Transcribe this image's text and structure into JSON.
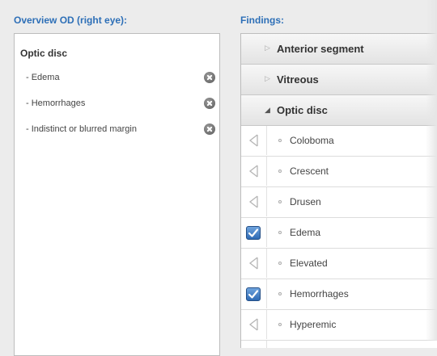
{
  "headers": {
    "overview": "Overview OD (right eye):",
    "findings": "Findings:"
  },
  "overview": {
    "title": "Optic disc",
    "items": [
      {
        "label": "- Edema"
      },
      {
        "label": "- Hemorrhages"
      },
      {
        "label": "- Indistinct or blurred margin"
      }
    ]
  },
  "findings": {
    "sections": [
      {
        "label": "Anterior segment",
        "expanded": false
      },
      {
        "label": "Vitreous",
        "expanded": false
      },
      {
        "label": "Optic disc",
        "expanded": true
      }
    ],
    "items": [
      {
        "label": "Coloboma",
        "checked": false
      },
      {
        "label": "Crescent",
        "checked": false
      },
      {
        "label": "Drusen",
        "checked": false
      },
      {
        "label": "Edema",
        "checked": true
      },
      {
        "label": "Elevated",
        "checked": false
      },
      {
        "label": "Hemorrhages",
        "checked": true
      },
      {
        "label": "Hyperemic",
        "checked": false
      }
    ]
  },
  "colors": {
    "header_text": "#2d6fb7",
    "checkbox_blue": "#2e6ab4"
  }
}
